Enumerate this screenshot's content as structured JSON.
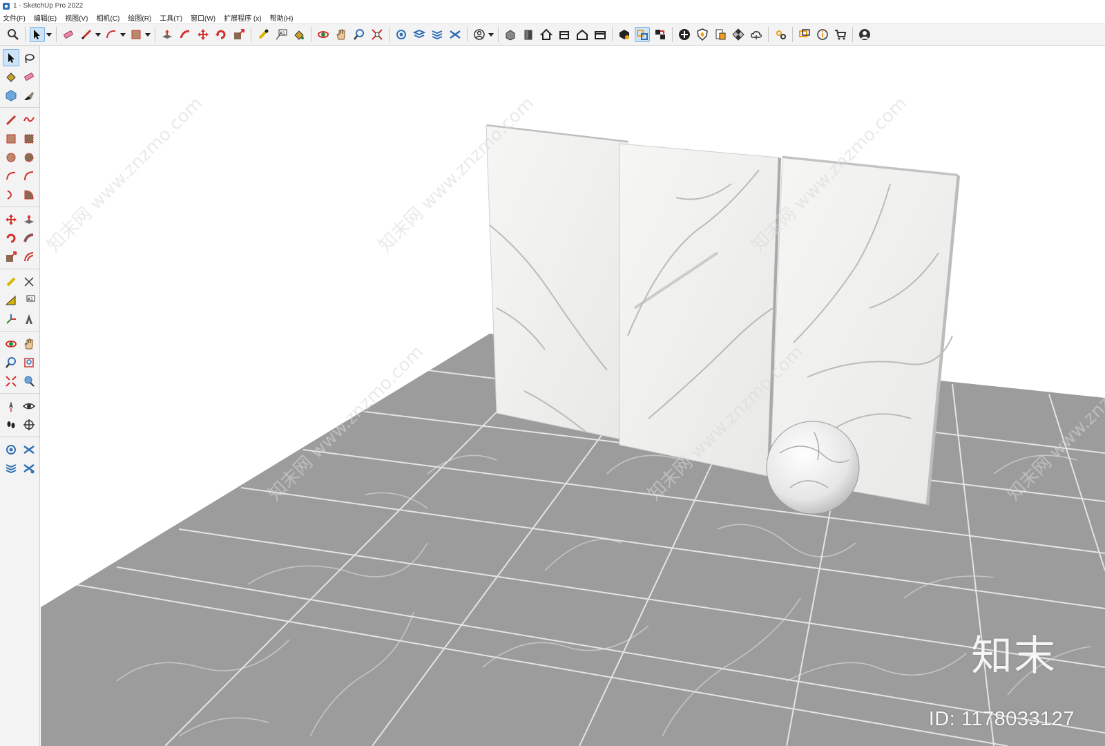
{
  "window": {
    "title": "1 - SketchUp Pro 2022"
  },
  "menu": [
    "文件(F)",
    "编辑(E)",
    "视图(V)",
    "相机(C)",
    "绘图(R)",
    "工具(T)",
    "窗口(W)",
    "扩展程序 (x)",
    "帮助(H)"
  ],
  "colors": {
    "accent": "#cde3f7",
    "floor": "#9c9c9c",
    "grout": "#e4e4e4",
    "marble": "#f0f0ee",
    "vein": "#b9bcb5"
  },
  "toolbar_icons": [
    "zoom-icon",
    "select-icon",
    "eraser-icon",
    "pencil-icon",
    "arc-icon",
    "rectangle-icon",
    "push-pull-icon",
    "follow-me-icon",
    "move-icon",
    "rotate-icon",
    "scale-icon",
    "tape-measure-icon",
    "text-icon",
    "paint-bucket-icon",
    "orbit-icon",
    "pan-icon",
    "zoom-window-icon",
    "zoom-extents-icon",
    "sandbox-icon",
    "layer-icon",
    "styles-icon",
    "account-icon",
    "iso-view-icon",
    "front-view-icon",
    "home-view-icon",
    "back-view-icon",
    "right-view-icon",
    "top-view-icon",
    "warehouse-icon",
    "component-icon",
    "solid-tools-icon",
    "add-icon",
    "shield-icon",
    "layout-icon",
    "checker-icon",
    "cloud-icon",
    "settings-icon",
    "chat-icon",
    "info-icon",
    "cart-icon",
    "profile-icon"
  ],
  "watermark": {
    "logo": "知末",
    "id": "ID: 1178033127",
    "site": "知末网 www.znzmo.com"
  }
}
